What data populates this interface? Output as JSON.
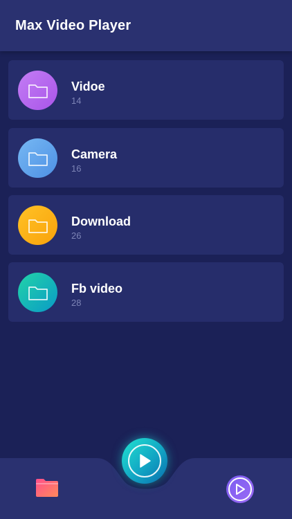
{
  "header": {
    "title": "Max Video Player"
  },
  "folders": [
    {
      "name": "Vidoe",
      "count": "14",
      "gradient_from": "#c37df4",
      "gradient_to": "#a955e9"
    },
    {
      "name": "Camera",
      "count": "16",
      "gradient_from": "#76b8f3",
      "gradient_to": "#4e90e4"
    },
    {
      "name": "Download",
      "count": "26",
      "gradient_from": "#ffc226",
      "gradient_to": "#f9a20b"
    },
    {
      "name": "Fb video",
      "count": "28",
      "gradient_from": "#22d3a8",
      "gradient_to": "#0a9bc6"
    }
  ],
  "bottom_nav": {
    "folders_icon": "folder-icon",
    "play_fab_icon": "play-icon",
    "player_icon": "play-circle-icon"
  },
  "colors": {
    "background": "#1b2157",
    "card": "#262d6b",
    "header": "#2a3170",
    "bottom_bar": "#2a3170",
    "count_text": "#7d84b6",
    "fab": "#18c3d3",
    "player_button": "#8a63f2"
  }
}
